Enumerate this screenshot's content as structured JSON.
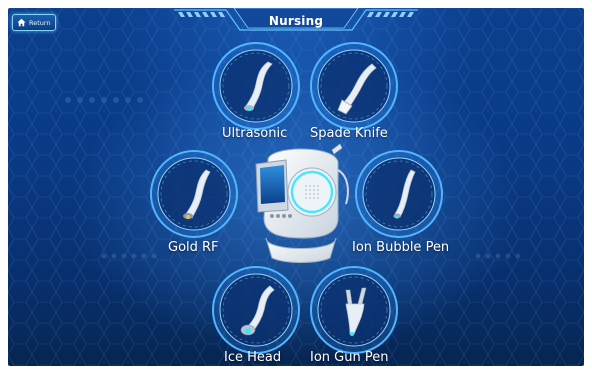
{
  "header": {
    "title": "Nursing",
    "return_label": "Return"
  },
  "tools": [
    {
      "id": "ultrasonic",
      "label": "Ultrasonic",
      "icon": "ultrasonic-handpiece-icon"
    },
    {
      "id": "spade-knife",
      "label": "Spade Knife",
      "icon": "spade-knife-handpiece-icon"
    },
    {
      "id": "gold-rf",
      "label": "Gold RF",
      "icon": "gold-rf-handpiece-icon"
    },
    {
      "id": "ion-bubble-pen",
      "label": "Ion Bubble Pen",
      "icon": "ion-bubble-pen-icon"
    },
    {
      "id": "ice-head",
      "label": "Ice Head",
      "icon": "ice-head-handpiece-icon"
    },
    {
      "id": "ion-gun-pen",
      "label": "Ion Gun Pen",
      "icon": "ion-gun-pen-icon"
    }
  ],
  "colors": {
    "background": "#0a3a86",
    "ring": "#4fb6ff",
    "accent": "#7fd4ff",
    "label": "#ffffff"
  }
}
